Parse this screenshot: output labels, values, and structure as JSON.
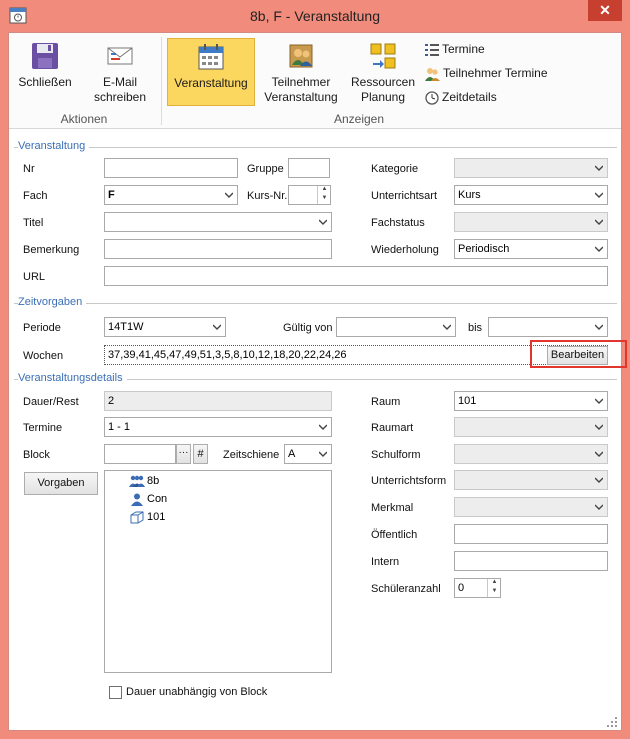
{
  "window": {
    "title": "8b, F - Veranstaltung",
    "close_glyph": "✕"
  },
  "ribbon": {
    "close_label": "Schließen",
    "email_label_line1": "E-Mail",
    "email_label_line2": "schreiben",
    "group_actions": "Aktionen",
    "veranstaltung_label": "Veranstaltung",
    "teilnehmer_line1": "Teilnehmer",
    "teilnehmer_line2": "Veranstaltung",
    "ressourcen_line1": "Ressourcen",
    "ressourcen_line2": "Planung",
    "termine_label": "Termine",
    "teilnehmer_termine_label": "Teilnehmer Termine",
    "zeitdetails_label": "Zeitdetails",
    "group_views": "Anzeigen"
  },
  "sections": {
    "veranstaltung": "Veranstaltung",
    "zeitvorgaben": "Zeitvorgaben",
    "details": "Veranstaltungsdetails"
  },
  "veranstaltung": {
    "nr_label": "Nr",
    "nr_value": "",
    "gruppe_label": "Gruppe",
    "gruppe_value": "",
    "kategorie_label": "Kategorie",
    "kategorie_value": "",
    "fach_label": "Fach",
    "fach_value": "F",
    "kursnr_label": "Kurs-Nr.",
    "kursnr_value": "",
    "unterrichtsart_label": "Unterrichtsart",
    "unterrichtsart_value": "Kurs",
    "titel_label": "Titel",
    "titel_value": "",
    "fachstatus_label": "Fachstatus",
    "fachstatus_value": "",
    "bemerkung_label": "Bemerkung",
    "bemerkung_value": "",
    "wiederholung_label": "Wiederholung",
    "wiederholung_value": "Periodisch",
    "url_label": "URL",
    "url_value": ""
  },
  "zeitvorgaben": {
    "periode_label": "Periode",
    "periode_value": "14T1W",
    "gueltig_label": "Gültig von",
    "gueltig_value": "",
    "bis_label": "bis",
    "bis_value": "",
    "wochen_label": "Wochen",
    "wochen_value": "37,39,41,45,47,49,51,3,5,8,10,12,18,20,22,24,26",
    "bearbeiten_label": "Bearbeiten"
  },
  "details": {
    "dauer_label": "Dauer/Rest",
    "dauer_value": "2",
    "termine_label": "Termine",
    "termine_value": "1 - 1",
    "block_label": "Block",
    "block_value": "",
    "block_browse": "···",
    "block_hash": "#",
    "zeitschiene_label": "Zeitschiene",
    "zeitschiene_value": "A",
    "vorgaben_label": "Vorgaben",
    "tree": [
      {
        "label": "8b",
        "icon": "group-icon"
      },
      {
        "label": "Con",
        "icon": "person-icon"
      },
      {
        "label": "101",
        "icon": "room-cube-icon"
      }
    ],
    "dauer_checkbox_label": "Dauer unabhängig von Block",
    "raum_label": "Raum",
    "raum_value": "101",
    "raumart_label": "Raumart",
    "raumart_value": "",
    "schulform_label": "Schulform",
    "schulform_value": "",
    "unterrichtsform_label": "Unterrichtsform",
    "unterrichtsform_value": "",
    "merkmal_label": "Merkmal",
    "merkmal_value": "",
    "oeffentlich_label": "Öffentlich",
    "oeffentlich_value": "",
    "intern_label": "Intern",
    "intern_value": "",
    "schueleranzahl_label": "Schüleranzahl",
    "schueleranzahl_value": "0"
  },
  "colors": {
    "window_frame": "#f18b7b",
    "close_button": "#c7402f",
    "section_title": "#3a6fb6",
    "active_ribbon": "#fcd75f",
    "highlight": "#e0362c"
  }
}
